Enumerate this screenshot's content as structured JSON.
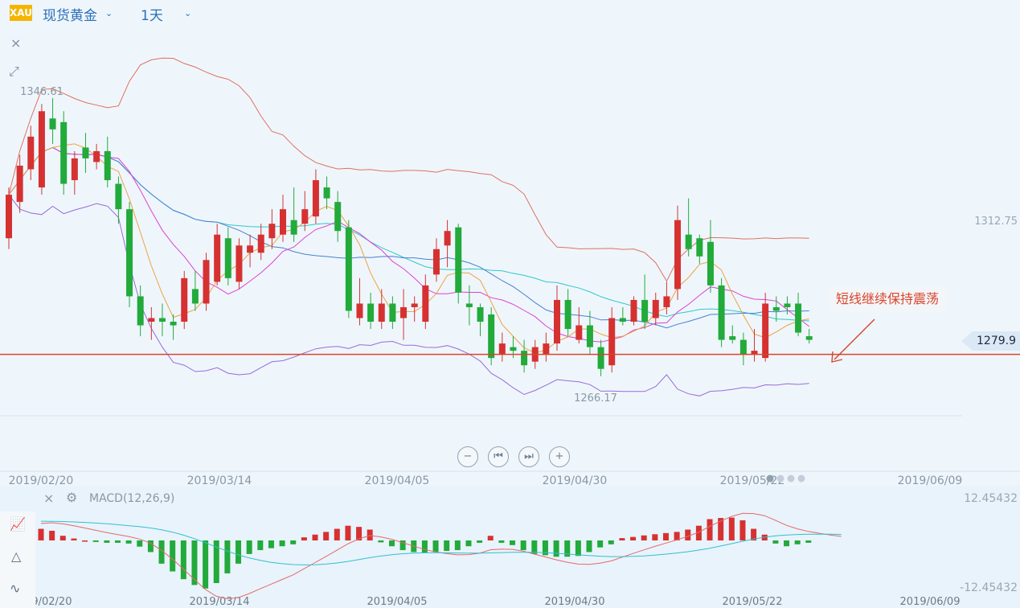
{
  "header": {
    "symbol_badge": "XAU",
    "symbol_name": "现货黄金",
    "period": "1天"
  },
  "toolbar": {
    "close_glyph": "×",
    "collapse_icon": "collapse-arrows-icon"
  },
  "annotation": {
    "text": "短线继续保持震荡"
  },
  "price_tag": {
    "value": "1279.9",
    "color": "#d9442a"
  },
  "nav_buttons": [
    "−",
    "⏮",
    "⏭",
    "+"
  ],
  "macd_panel": {
    "label": "MACD(12,26,9)",
    "close_glyph": "×",
    "axis_top": "12.45432",
    "axis_bottom": "-12.45432"
  },
  "colors": {
    "up": "#d63131",
    "down": "#22aa3a",
    "support_line": "#d9442a",
    "ma5": "#f0a040",
    "ma10": "#e040d0",
    "ma20": "#4a7fd0",
    "ma30": "#30c8c8",
    "boll_upper": "#e07060",
    "boll_lower": "#9a6ad8",
    "dif": "#e36a6a",
    "dea": "#30c0d0"
  },
  "chart_data": {
    "type": "candlestick",
    "price_high_label": "1346.61",
    "price_low_label": "1266.17",
    "y_tick_labels": [
      "1312.75"
    ],
    "support_level": 1276,
    "x_tick_labels": [
      "2019/02/20",
      "2019/03/14",
      "2019/04/05",
      "2019/04/30",
      "2019/05/22",
      "2019/06/09"
    ],
    "macd_x_tick_labels": [
      "2019/02/20",
      "2019/03/14",
      "2019/04/05",
      "2019/04/30",
      "2019/05/22",
      "2019/06/09"
    ],
    "candles": [
      [
        1308,
        1320,
        1322,
        1305
      ],
      [
        1318,
        1328,
        1331,
        1315
      ],
      [
        1327,
        1336,
        1339,
        1324
      ],
      [
        1322,
        1343,
        1345,
        1320
      ],
      [
        1341,
        1338,
        1346.61,
        1334
      ],
      [
        1340,
        1323,
        1343,
        1320
      ],
      [
        1324,
        1330,
        1332,
        1320
      ],
      [
        1333,
        1330,
        1337,
        1326
      ],
      [
        1329,
        1332,
        1334,
        1327
      ],
      [
        1332,
        1324,
        1336,
        1322
      ],
      [
        1323,
        1316,
        1325,
        1312
      ],
      [
        1316,
        1292,
        1318,
        1289
      ],
      [
        1292,
        1284,
        1295,
        1281
      ],
      [
        1285,
        1286,
        1289,
        1280
      ],
      [
        1286,
        1285,
        1290,
        1281
      ],
      [
        1285,
        1284,
        1287,
        1280
      ],
      [
        1285,
        1297,
        1299,
        1283
      ],
      [
        1294,
        1290,
        1299,
        1288
      ],
      [
        1290,
        1302,
        1304,
        1288
      ],
      [
        1296,
        1309,
        1312,
        1295
      ],
      [
        1308,
        1297,
        1311,
        1295
      ],
      [
        1296,
        1306,
        1308,
        1294
      ],
      [
        1304,
        1306,
        1309,
        1300
      ],
      [
        1304,
        1309,
        1312,
        1302
      ],
      [
        1308,
        1312,
        1316,
        1305
      ],
      [
        1309,
        1316,
        1320,
        1307
      ],
      [
        1313,
        1309,
        1322,
        1307
      ],
      [
        1312,
        1316,
        1321,
        1310
      ],
      [
        1314,
        1324,
        1327,
        1312
      ],
      [
        1322,
        1319,
        1325,
        1316
      ],
      [
        1318,
        1310,
        1321,
        1307
      ],
      [
        1311,
        1288,
        1313,
        1286
      ],
      [
        1286,
        1290,
        1297,
        1284
      ],
      [
        1290,
        1285,
        1293,
        1283
      ],
      [
        1285,
        1290,
        1294,
        1283
      ],
      [
        1290,
        1285,
        1292,
        1283
      ],
      [
        1286,
        1289,
        1294,
        1280
      ],
      [
        1289,
        1290,
        1292,
        1285
      ],
      [
        1285,
        1295,
        1298,
        1283
      ],
      [
        1298,
        1305,
        1308,
        1296
      ],
      [
        1306,
        1310,
        1313,
        1300
      ],
      [
        1311,
        1293,
        1312,
        1290
      ],
      [
        1290,
        1289,
        1295,
        1284
      ],
      [
        1289,
        1285,
        1290,
        1281
      ],
      [
        1287,
        1275,
        1289,
        1273
      ],
      [
        1276,
        1279,
        1282,
        1274
      ],
      [
        1278,
        1277,
        1281,
        1275
      ],
      [
        1277,
        1273,
        1280,
        1271
      ],
      [
        1274,
        1278,
        1280,
        1272
      ],
      [
        1276,
        1279,
        1282,
        1274
      ],
      [
        1279,
        1291,
        1295,
        1277
      ],
      [
        1291,
        1283,
        1294,
        1281
      ],
      [
        1280,
        1284,
        1289,
        1279
      ],
      [
        1284,
        1278,
        1288,
        1276
      ],
      [
        1278,
        1272,
        1280,
        1270
      ],
      [
        1273,
        1286,
        1289,
        1271
      ],
      [
        1286,
        1285,
        1289,
        1284
      ],
      [
        1285,
        1291,
        1292,
        1284
      ],
      [
        1291,
        1285,
        1298,
        1283
      ],
      [
        1286,
        1291,
        1293,
        1284
      ],
      [
        1289,
        1292,
        1296,
        1287
      ],
      [
        1294,
        1313,
        1317,
        1291
      ],
      [
        1309,
        1305,
        1319,
        1303
      ],
      [
        1308,
        1303,
        1309,
        1301
      ],
      [
        1307,
        1295,
        1313,
        1293
      ],
      [
        1295,
        1280,
        1297,
        1278
      ],
      [
        1281,
        1280,
        1284,
        1279
      ],
      [
        1280,
        1276,
        1282,
        1273
      ],
      [
        1276,
        1277,
        1283,
        1274
      ],
      [
        1275,
        1290,
        1293,
        1274
      ],
      [
        1289,
        1288,
        1292,
        1285
      ],
      [
        1290,
        1289,
        1292,
        1287
      ],
      [
        1290,
        1282,
        1293,
        1281
      ],
      [
        1281,
        1280,
        1283,
        1279
      ]
    ],
    "macd_hist": [
      3.0,
      2.5,
      1.2,
      0.5,
      0.0,
      -0.4,
      -0.6,
      -0.6,
      -0.8,
      -1.6,
      -3.0,
      -6.0,
      -8.0,
      -10.0,
      -11.5,
      -12.4,
      -11.0,
      -8.5,
      -6.0,
      -3.5,
      -2.5,
      -2.0,
      -1.5,
      -1.0,
      0.8,
      1.5,
      2.2,
      3.0,
      3.8,
      3.5,
      2.8,
      -0.5,
      -1.5,
      -2.5,
      -3.0,
      -3.2,
      -3.0,
      -2.7,
      -2.5,
      -1.5,
      -0.6,
      1.2,
      -0.6,
      -1.2,
      -2.5,
      -3.5,
      -3.8,
      -4.2,
      -4.2,
      -4.0,
      -3.0,
      -1.8,
      -1.0,
      0.6,
      0.9,
      1.3,
      1.6,
      1.9,
      2.2,
      2.8,
      3.8,
      5.5,
      5.8,
      5.9,
      5.2,
      3.0,
      1.5,
      -0.8,
      -1.5,
      -1.0,
      -0.6,
      -0.4,
      -0.5,
      -0.5
    ]
  }
}
